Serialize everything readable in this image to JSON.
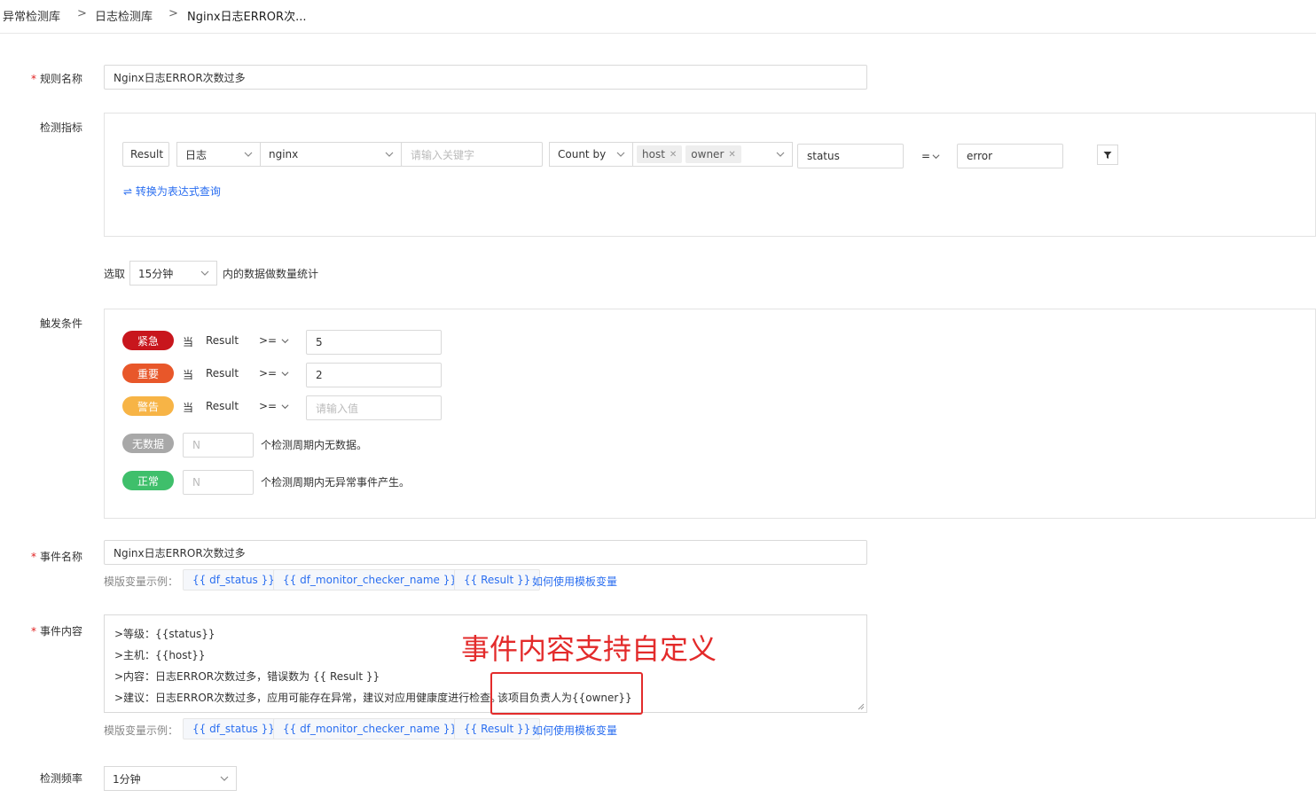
{
  "breadcrumb": {
    "items": [
      "异常检测库",
      "日志检测库",
      "Nginx日志ERROR次..."
    ],
    "separator": ">"
  },
  "rule_name": {
    "label": "规则名称",
    "value": "Nginx日志ERROR次数过多"
  },
  "metric": {
    "label": "检测指标",
    "result_label": "Result",
    "source_select": "日志",
    "index_select": "nginx",
    "keyword_placeholder": "请输入关键字",
    "count_by": "Count by",
    "tags": [
      "host",
      "owner"
    ],
    "filter_field": "status",
    "operator": "=",
    "filter_value": "error",
    "convert_link": "⇌ 转换为表达式查询"
  },
  "period": {
    "prefix": "选取",
    "value": "15分钟",
    "suffix": "内的数据做数量统计"
  },
  "trigger": {
    "label": "触发条件",
    "levels": [
      {
        "name": "紧急",
        "when": "当",
        "metric": "Result",
        "op": ">=",
        "value": "5",
        "placeholder": "",
        "color": "#c8161d"
      },
      {
        "name": "重要",
        "when": "当",
        "metric": "Result",
        "op": ">=",
        "value": "2",
        "placeholder": "",
        "color": "#e8572a"
      },
      {
        "name": "警告",
        "when": "当",
        "metric": "Result",
        "op": ">=",
        "value": "",
        "placeholder": "请输入值",
        "color": "#f7b446"
      }
    ],
    "no_data": {
      "name": "无数据",
      "placeholder": "N",
      "suffix": "个检测周期内无数据。",
      "color": "#a8a8a8"
    },
    "normal": {
      "name": "正常",
      "placeholder": "N",
      "suffix": "个检测周期内无异常事件产生。",
      "color": "#3fbf6b"
    }
  },
  "event_name": {
    "label": "事件名称",
    "value": "Nginx日志ERROR次数过多",
    "var_label": "模版变量示例：",
    "vars": [
      "{{ df_status }}",
      "{{ df_monitor_checker_name }}",
      "{{ Result }}"
    ],
    "help_link": "如何使用模板变量"
  },
  "event_content": {
    "label": "事件内容",
    "lines": [
      ">等级：{{status}}",
      ">主机：{{host}}",
      ">内容：日志ERROR次数过多，错误数为 {{ Result }}",
      ">建议：日志ERROR次数过多，应用可能存在异常，建议对应用健康度进行检查。"
    ],
    "highlight": "该项目负责人为{{owner}}",
    "var_label": "模版变量示例：",
    "vars": [
      "{{ df_status }}",
      "{{ df_monitor_checker_name }}",
      "{{ Result }}"
    ],
    "help_link": "如何使用模板变量"
  },
  "annotation": {
    "text": "事件内容支持自定义",
    "color": "#e32b2b"
  },
  "frequency": {
    "label": "检测频率",
    "value": "1分钟"
  }
}
